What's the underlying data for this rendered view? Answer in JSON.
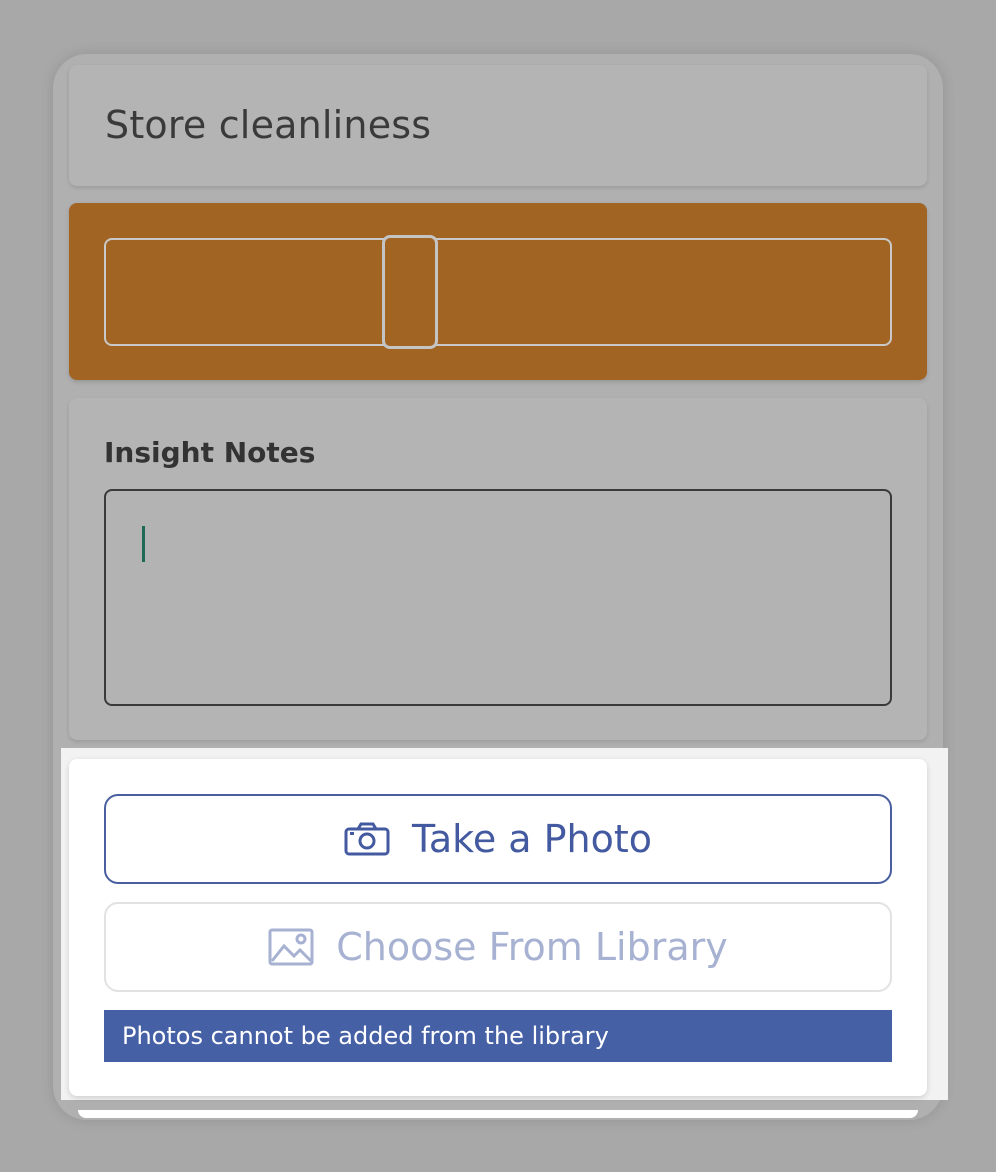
{
  "title_card": {
    "title": "Store cleanliness"
  },
  "slider": {
    "value_fraction": 0.38,
    "accent_color": "#a26423"
  },
  "notes": {
    "label": "Insight Notes",
    "value": "",
    "placeholder": ""
  },
  "photo_sheet": {
    "take_photo_label": "Take a Photo",
    "take_photo_icon": "camera-icon",
    "library_label": "Choose From Library",
    "library_icon": "image-icon",
    "library_disabled": true,
    "notice_text": "Photos cannot be added from the library",
    "primary_color": "#445aa0"
  }
}
